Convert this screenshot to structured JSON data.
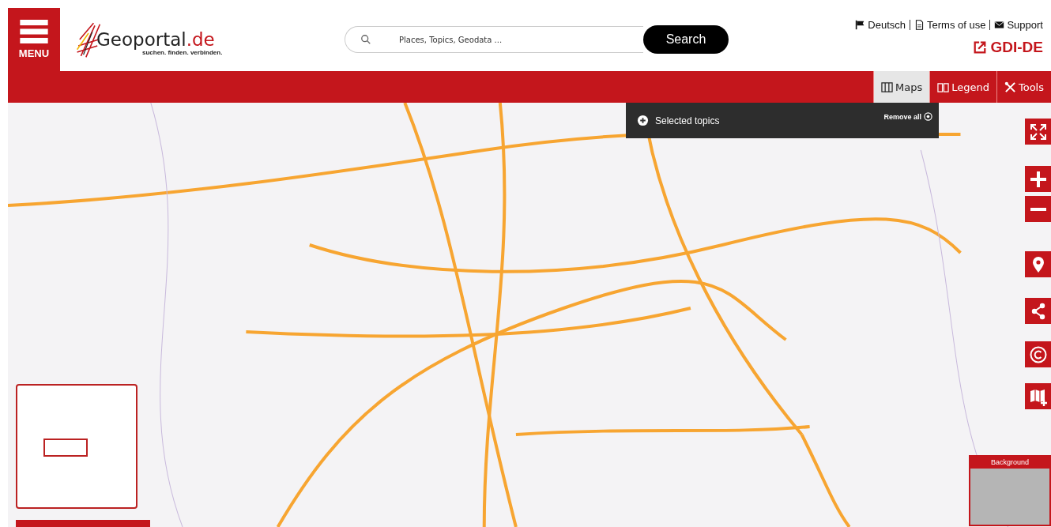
{
  "header": {
    "menu_label": "MENU",
    "logo_text": "Geoportal",
    "logo_suffix": ".de",
    "tagline": "suchen. finden. verbinden.",
    "search": {
      "placeholder": "Places, Topics, Geodata ..."
    },
    "search_button": "Search",
    "links": [
      {
        "kind": "flag",
        "label": "Deutsch"
      },
      {
        "kind": "doc",
        "label": "Terms of use"
      },
      {
        "kind": "mail",
        "label": "Support"
      }
    ],
    "gdi_link": "GDI-DE"
  },
  "tabs": [
    {
      "kind": "maps",
      "label": "Maps",
      "selected": true
    },
    {
      "kind": "legend",
      "label": "Legend",
      "selected": false
    },
    {
      "kind": "tools",
      "label": "Tools",
      "selected": false
    }
  ],
  "topics_panel": {
    "title": "Selected topics",
    "remove_all": "Remove all"
  },
  "map_controls": [
    {
      "kind": "fullscreen"
    },
    {
      "kind": "zoom-in"
    },
    {
      "kind": "zoom-out"
    },
    {
      "kind": "location"
    },
    {
      "kind": "share"
    },
    {
      "kind": "copyright"
    },
    {
      "kind": "add-map"
    }
  ],
  "background_switcher": {
    "title": "Background"
  }
}
